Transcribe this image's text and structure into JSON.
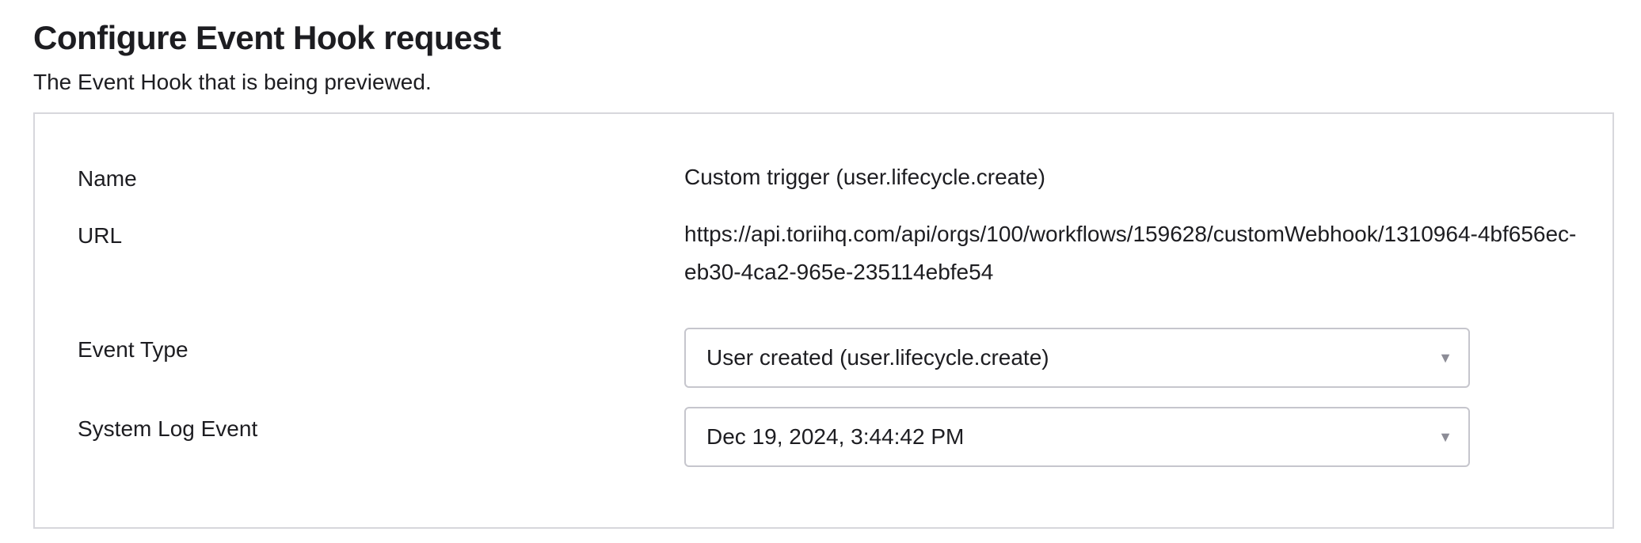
{
  "header": {
    "title": "Configure Event Hook request",
    "subtitle": "The Event Hook that is being previewed."
  },
  "form": {
    "name": {
      "label": "Name",
      "value": "Custom trigger (user.lifecycle.create)"
    },
    "url": {
      "label": "URL",
      "value": "https://api.toriihq.com/api/orgs/100/workflows/159628/customWebhook/1310964-4bf656ec-eb30-4ca2-965e-235114ebfe54"
    },
    "event_type": {
      "label": "Event Type",
      "selected": "User created (user.lifecycle.create)"
    },
    "system_log_event": {
      "label": "System Log Event",
      "selected": "Dec 19, 2024, 3:44:42 PM"
    }
  },
  "icons": {
    "dropdown": "caret-down-icon"
  },
  "colors": {
    "text": "#1d1d21",
    "panel_border": "#d7d7dc",
    "select_border": "#c6c6cd",
    "caret": "#8c8c96"
  }
}
